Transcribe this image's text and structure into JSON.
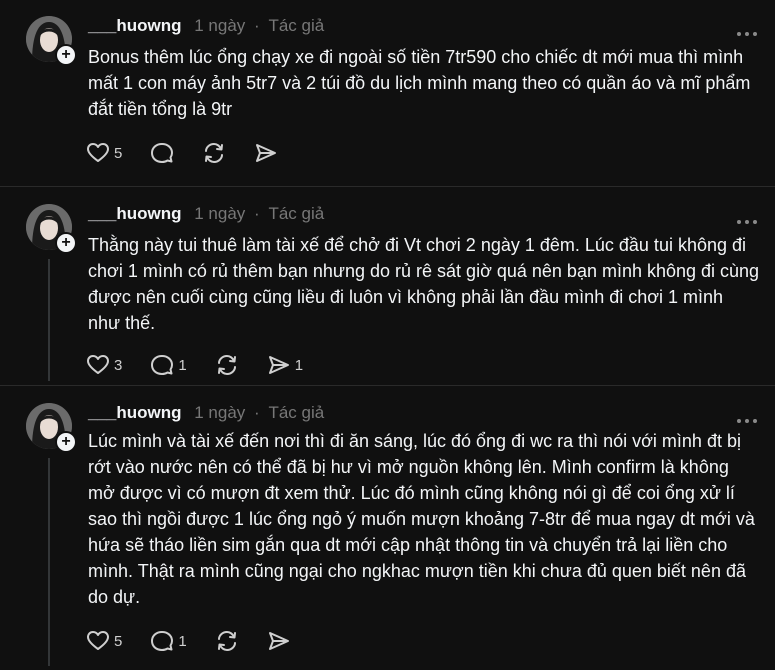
{
  "posts": [
    {
      "username": "___huowng",
      "time": "1 ngày",
      "separator": "·",
      "role": "Tác giả",
      "text": "Bonus thêm lúc ổng chạy xe đi ngoài số tiền 7tr590 cho chiếc dt mới mua thì mình mất 1 con máy ảnh 5tr7 và 2 túi đồ du lịch mình mang theo có quần áo và mĩ phẩm đắt tiền tổng là 9tr",
      "likes": "5",
      "replies": "",
      "shares": ""
    },
    {
      "username": "___huowng",
      "time": "1 ngày",
      "separator": "·",
      "role": "Tác giả",
      "text": "Thằng này tui thuê làm tài xế để chở đi Vt chơi 2 ngày 1 đêm. Lúc đầu tui không đi chơi 1 mình có rủ thêm bạn nhưng do rủ rê sát giờ quá nên bạn mình không đi cùng được nên cuối cùng cũng liều đi luôn vì không phải lần đầu mình đi chơi 1 mình như thế.",
      "likes": "3",
      "replies": "1",
      "shares": "1"
    },
    {
      "username": "___huowng",
      "time": "1 ngày",
      "separator": "·",
      "role": "Tác giả",
      "text": "Lúc mình và tài xế đến nơi thì đi ăn sáng, lúc đó ổng đi wc ra thì nói với mình đt bị rớt vào nước nên có thể đã bị hư vì mở nguồn không lên. Mình confirm là không mở được vì có mượn đt xem thử. Lúc đó mình cũng không nói gì để coi ổng xử lí sao thì ngồi được 1 lúc ổng ngỏ ý muốn mượn khoảng 7-8tr để mua ngay dt mới và hứa sẽ tháo liền sim gắn qua dt mới cập nhật thông tin và chuyển trả lại liền cho mình. Thật ra mình cũng ngại cho ngkhac mượn tiền khi chưa đủ quen biết nên đã do dự.",
      "likes": "5",
      "replies": "1",
      "shares": ""
    }
  ],
  "icons": {
    "avatar": "avatar-photo",
    "follow": "plus-icon",
    "more": "more-horizontal-icon",
    "like": "heart-icon",
    "reply": "comment-icon",
    "repost": "repost-icon",
    "share": "send-icon"
  },
  "colors": {
    "background": "#101010",
    "text": "#f3f5f7",
    "muted": "#777777",
    "divider": "#2a2a2a"
  }
}
